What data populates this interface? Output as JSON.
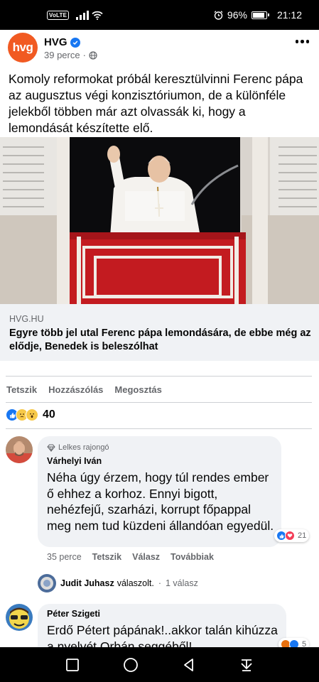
{
  "status_bar": {
    "volte": "VoLTE",
    "battery_percent": "96%",
    "battery_level": 0.96,
    "time": "21:12"
  },
  "post": {
    "page_name": "HVG",
    "avatar_text": "hvg",
    "time_ago": "39 perce",
    "text": "Komoly reformokat próbál keresztülvinni Ferenc pápa az augusztus végi konzisztóriumon, de a különféle jelekből többen már azt olvassák ki, hogy a lemondását készítette elő.",
    "link": {
      "domain": "HVG.HU",
      "title": "Egyre több jel utal Ferenc pápa lemondására, de ebbe még az elődje, Benedek is beleszólhat"
    },
    "actions": {
      "like": "Tetszik",
      "comment": "Hozzászólás",
      "share": "Megosztás"
    },
    "reaction_count": "40"
  },
  "comments": [
    {
      "badge": "Lelkes rajongó",
      "author": "Várhelyi Iván",
      "text": "Néha úgy érzem, hogy túl rendes ember ő ehhez a korhoz. Ennyi bigott, nehézfejű, szarházi, korrupt főpappal meg nem tud küzdeni állandóan egyedül.",
      "reaction_count": "21",
      "time_ago": "35 perce",
      "like": "Tetszik",
      "reply": "Válasz",
      "more": "Továbbiak",
      "reply_summary": {
        "author": "Judit Juhasz",
        "action": "válaszolt.",
        "count": "1 válasz"
      }
    },
    {
      "author": "Péter Szigeti",
      "text": "Erdő Pétert pápának!..akkor talán kihúzza a nyelvét Orbán seggéből!",
      "reaction_count": "5"
    }
  ],
  "colors": {
    "hvg_orange": "#f15a22",
    "facebook_blue": "#1877f2",
    "bubble_gray": "#f0f2f5",
    "secondary_text": "#65676b"
  }
}
